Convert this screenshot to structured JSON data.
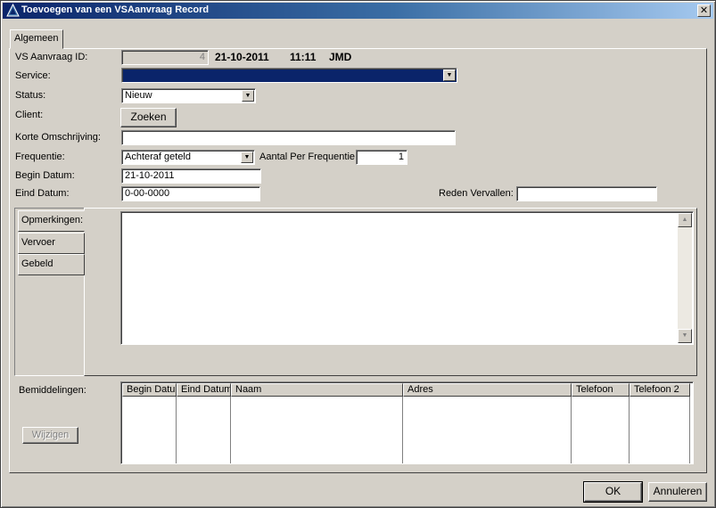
{
  "window": {
    "title": "Toevoegen van een VSAanvraag Record",
    "close_label": "✕"
  },
  "tabs": [
    {
      "label": "Algemeen"
    }
  ],
  "form": {
    "vs_id_label": "VS Aanvraag ID:",
    "vs_id_value": "4",
    "date": "21-10-2011",
    "time": "11:11",
    "user": "JMD",
    "service_label": "Service:",
    "service_value": "",
    "status_label": "Status:",
    "status_value": "Nieuw",
    "client_label": "Client:",
    "zoeken_label": "Zoeken",
    "korte_label": "Korte Omschrijving:",
    "korte_value": "",
    "frequentie_label": "Frequentie:",
    "frequentie_value": "Achteraf geteld",
    "aantal_label": "Aantal Per Frequentie:",
    "aantal_value": "1",
    "begin_label": "Begin Datum:",
    "begin_value": "21-10-2011",
    "eind_label": "Eind Datum:",
    "eind_value": "0-00-0000",
    "reden_label": "Reden Vervallen:",
    "reden_value": ""
  },
  "memo_tabs": [
    {
      "label": "Opmerkingen:"
    },
    {
      "label": "Vervoer"
    },
    {
      "label": "Gebeld"
    }
  ],
  "bemiddelingen": {
    "label": "Bemiddelingen:",
    "wijzigen_label": "Wijzigen",
    "columns": [
      "Begin Datum",
      "Eind Datum",
      "Naam",
      "Adres",
      "Telefoon",
      "Telefoon 2"
    ]
  },
  "footer": {
    "ok_label": "OK",
    "cancel_label": "Annuleren"
  },
  "icons": {
    "window": "app-triangle-icon",
    "close": "close-icon",
    "dropdown": "chevron-down-icon",
    "scroll_up": "scroll-up-icon",
    "scroll_down": "scroll-down-icon"
  },
  "colors": {
    "titlebar": "#0a246a",
    "face": "#d4d0c8",
    "selection": "#0a246a"
  }
}
